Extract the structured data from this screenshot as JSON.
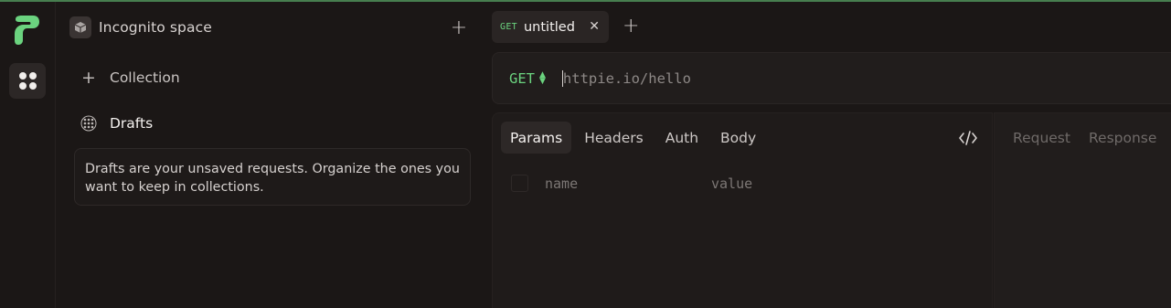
{
  "sidebar": {
    "space_name": "Incognito space",
    "items": [
      {
        "label": "Collection",
        "icon": "plus-icon"
      },
      {
        "label": "Drafts",
        "icon": "drafts-grid-icon"
      }
    ],
    "drafts_hint": "Drafts are your unsaved requests. Organize the ones you want to keep in collections."
  },
  "tabs": [
    {
      "method": "GET",
      "title": "untitled"
    }
  ],
  "request": {
    "method": "GET",
    "url_placeholder": "httpie.io/hello",
    "param_tabs": [
      "Params",
      "Headers",
      "Auth",
      "Body"
    ],
    "params": {
      "name_placeholder": "name",
      "value_placeholder": "value"
    }
  },
  "response": {
    "tabs": [
      "Request",
      "Response"
    ]
  },
  "colors": {
    "accent": "#6bd37f",
    "background": "#1b1716"
  }
}
